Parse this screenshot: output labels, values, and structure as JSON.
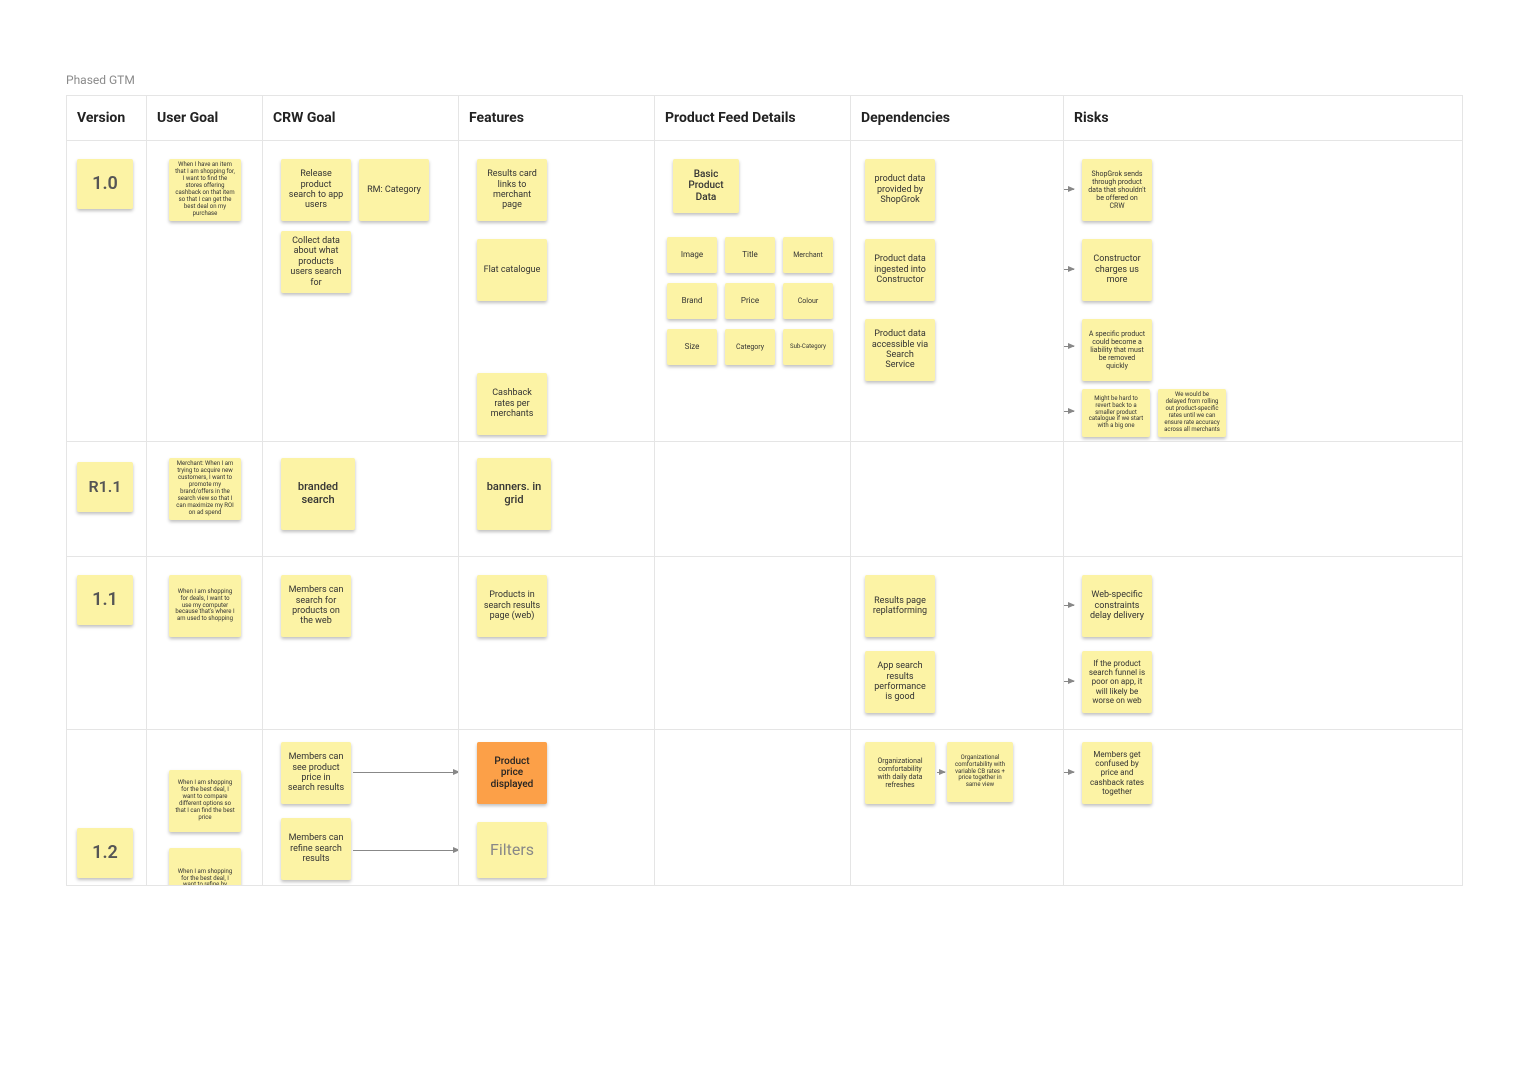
{
  "title": "Phased GTM",
  "headers": [
    "Version",
    "User Goal",
    "CRW Goal",
    "Features",
    "Product Feed Details",
    "Dependencies",
    "Risks"
  ],
  "rows": {
    "v10": {
      "version": "1.0",
      "user_goal": "When I have an item that I am shopping for, I want to find the stores offering cashback on that item so that I can get the best deal on my purchase",
      "crw_goal1": "Release product search to app users",
      "crw_goal_rm": "RM: Category",
      "crw_goal2": "Collect data about what products users search for",
      "feat1": "Results card links to merchant page",
      "feat2": "Flat catalogue",
      "feat3": "Cashback rates per merchants",
      "pfd_basic": "Basic Product Data",
      "pfd": [
        "Image",
        "Title",
        "Merchant",
        "Brand",
        "Price",
        "Colour",
        "Size",
        "Category",
        "Sub-Category"
      ],
      "dep1": "product data provided by ShopGrok",
      "dep2": "Product data ingested into Constructor",
      "dep3": "Product data accessible via Search Service",
      "risk1": "ShopGrok sends through product data that shouldn't be offered on CRW",
      "risk2": "Constructor charges us more",
      "risk3": "A specific product could become a liability that must be removed quickly",
      "risk4a": "Might be hard to revert back to a smaller product catalogue if we start with a big one",
      "risk4b": "We would be delayed from rolling out product-specific rates until we can ensure rate accuracy across all merchants"
    },
    "r11": {
      "version": "R1.1",
      "user_goal": "Merchant: When I am trying to acquire new customers, I want to promote my brand/offers in the search view so that I can maximize my ROI on ad spend",
      "crw_goal": "branded search",
      "feat": "banners. in grid"
    },
    "v11": {
      "version": "1.1",
      "user_goal": "When I am shopping for deals, I want to use my computer because that's where I am used to shopping",
      "crw_goal": "Members can search for products on the web",
      "feat": "Products in search results page (web)",
      "dep1": "Results page replatforming",
      "dep2": "App search results performance is good",
      "risk1": "Web-specific constraints delay delivery",
      "risk2": "If the product search funnel is poor on app, it will likely be worse on web"
    },
    "v12": {
      "version": "1.2",
      "user_goal1": "When I am shopping for the best deal, I want to compare different options so that I can find the best price",
      "user_goal2": "When I am shopping for the best deal, I want to refine by",
      "crw_goal1": "Members can see product price in search results",
      "crw_goal2": "Members can refine search results",
      "feat1": "Product price displayed",
      "feat2": "Filters",
      "dep1": "Organizational comfortability with daily data refreshes",
      "dep2": "Organizational comfortability with variable CB rates + price together in same view",
      "risk1": "Members get confused by price and cashback rates together"
    }
  }
}
